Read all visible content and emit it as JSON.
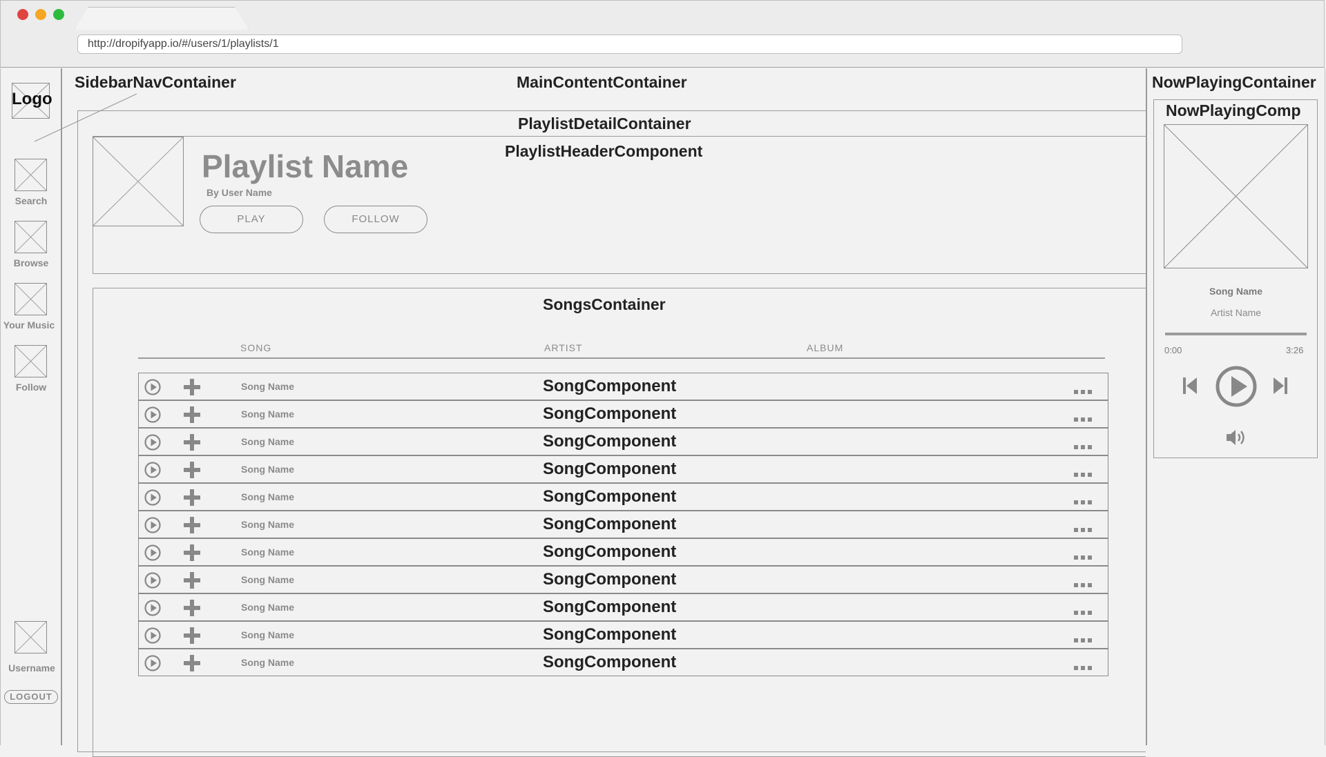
{
  "browser": {
    "url": "http://dropifyapp.io/#/users/1/playlists/1",
    "traffic_colors": {
      "close": "#e0443e",
      "minimize": "#f5a623",
      "maximize": "#2dbb3f"
    }
  },
  "sidebar": {
    "container_label": "SidebarNavContainer",
    "logo": "Logo",
    "items": [
      {
        "label": "Search"
      },
      {
        "label": "Browse"
      },
      {
        "label": "Your Music"
      },
      {
        "label": "Follow"
      }
    ],
    "user": {
      "label": "Username"
    },
    "logout_label": "LOGOUT"
  },
  "main": {
    "container_label": "MainContentContainer",
    "detail_label": "PlaylistDetailContainer",
    "header_label": "PlaylistHeaderComponent",
    "playlist": {
      "name": "Playlist Name",
      "by": "By User Name",
      "play_label": "PLAY",
      "follow_label": "FOLLOW"
    },
    "songs": {
      "container_label": "SongsContainer",
      "columns": [
        "SONG",
        "ARTIST",
        "ALBUM"
      ],
      "rows": [
        {
          "song": "Song Name",
          "component": "SongComponent"
        },
        {
          "song": "Song Name",
          "component": "SongComponent"
        },
        {
          "song": "Song Name",
          "component": "SongComponent"
        },
        {
          "song": "Song Name",
          "component": "SongComponent"
        },
        {
          "song": "Song Name",
          "component": "SongComponent"
        },
        {
          "song": "Song Name",
          "component": "SongComponent"
        },
        {
          "song": "Song Name",
          "component": "SongComponent"
        },
        {
          "song": "Song Name",
          "component": "SongComponent"
        },
        {
          "song": "Song Name",
          "component": "SongComponent"
        },
        {
          "song": "Song Name",
          "component": "SongComponent"
        },
        {
          "song": "Song Name",
          "component": "SongComponent"
        }
      ]
    }
  },
  "now_playing": {
    "container_label": "NowPlayingContainer",
    "comp_label": "NowPlayingComp",
    "song": "Song Name",
    "artist": "Artist Name",
    "elapsed": "0:00",
    "duration": "3:26",
    "progress": 0
  }
}
